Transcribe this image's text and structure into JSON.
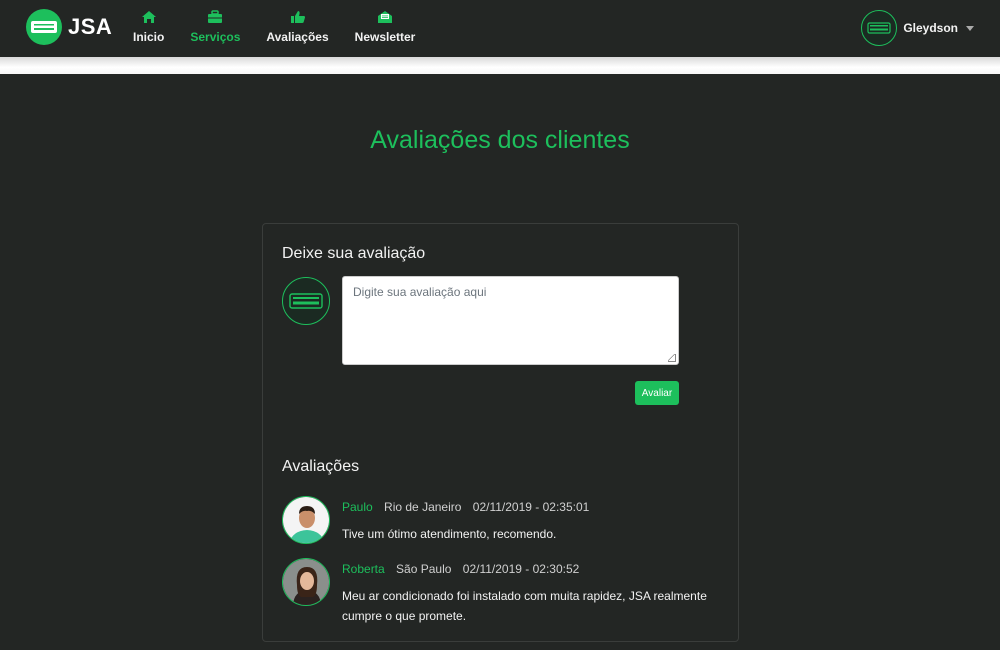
{
  "brand": {
    "name": "JSA"
  },
  "nav": {
    "items": [
      {
        "label": "Inicio",
        "icon": "home-icon",
        "active": false
      },
      {
        "label": "Serviços",
        "icon": "toolbox-icon",
        "active": true
      },
      {
        "label": "Avaliações",
        "icon": "thumbs-up-icon",
        "active": false
      },
      {
        "label": "Newsletter",
        "icon": "envelope-open-icon",
        "active": false
      }
    ]
  },
  "user": {
    "name": "Gleydson"
  },
  "page": {
    "title": "Avaliações dos clientes"
  },
  "form": {
    "heading": "Deixe sua avaliação",
    "placeholder": "Digite sua avaliação aqui",
    "value": "",
    "submit_label": "Avaliar"
  },
  "reviews": {
    "heading": "Avaliações",
    "items": [
      {
        "name": "Paulo",
        "city": "Rio de Janeiro",
        "date": "02/11/2019 - 02:35:01",
        "text": "Tive um ótimo atendimento, recomendo."
      },
      {
        "name": "Roberta",
        "city": "São Paulo",
        "date": "02/11/2019 - 02:30:52",
        "text": "Meu ar condicionado foi instalado com muita rapidez, JSA realmente cumpre o que promete."
      }
    ]
  },
  "colors": {
    "accent": "#1dbf5c",
    "background": "#232624",
    "card_border": "#3a3d3b"
  }
}
